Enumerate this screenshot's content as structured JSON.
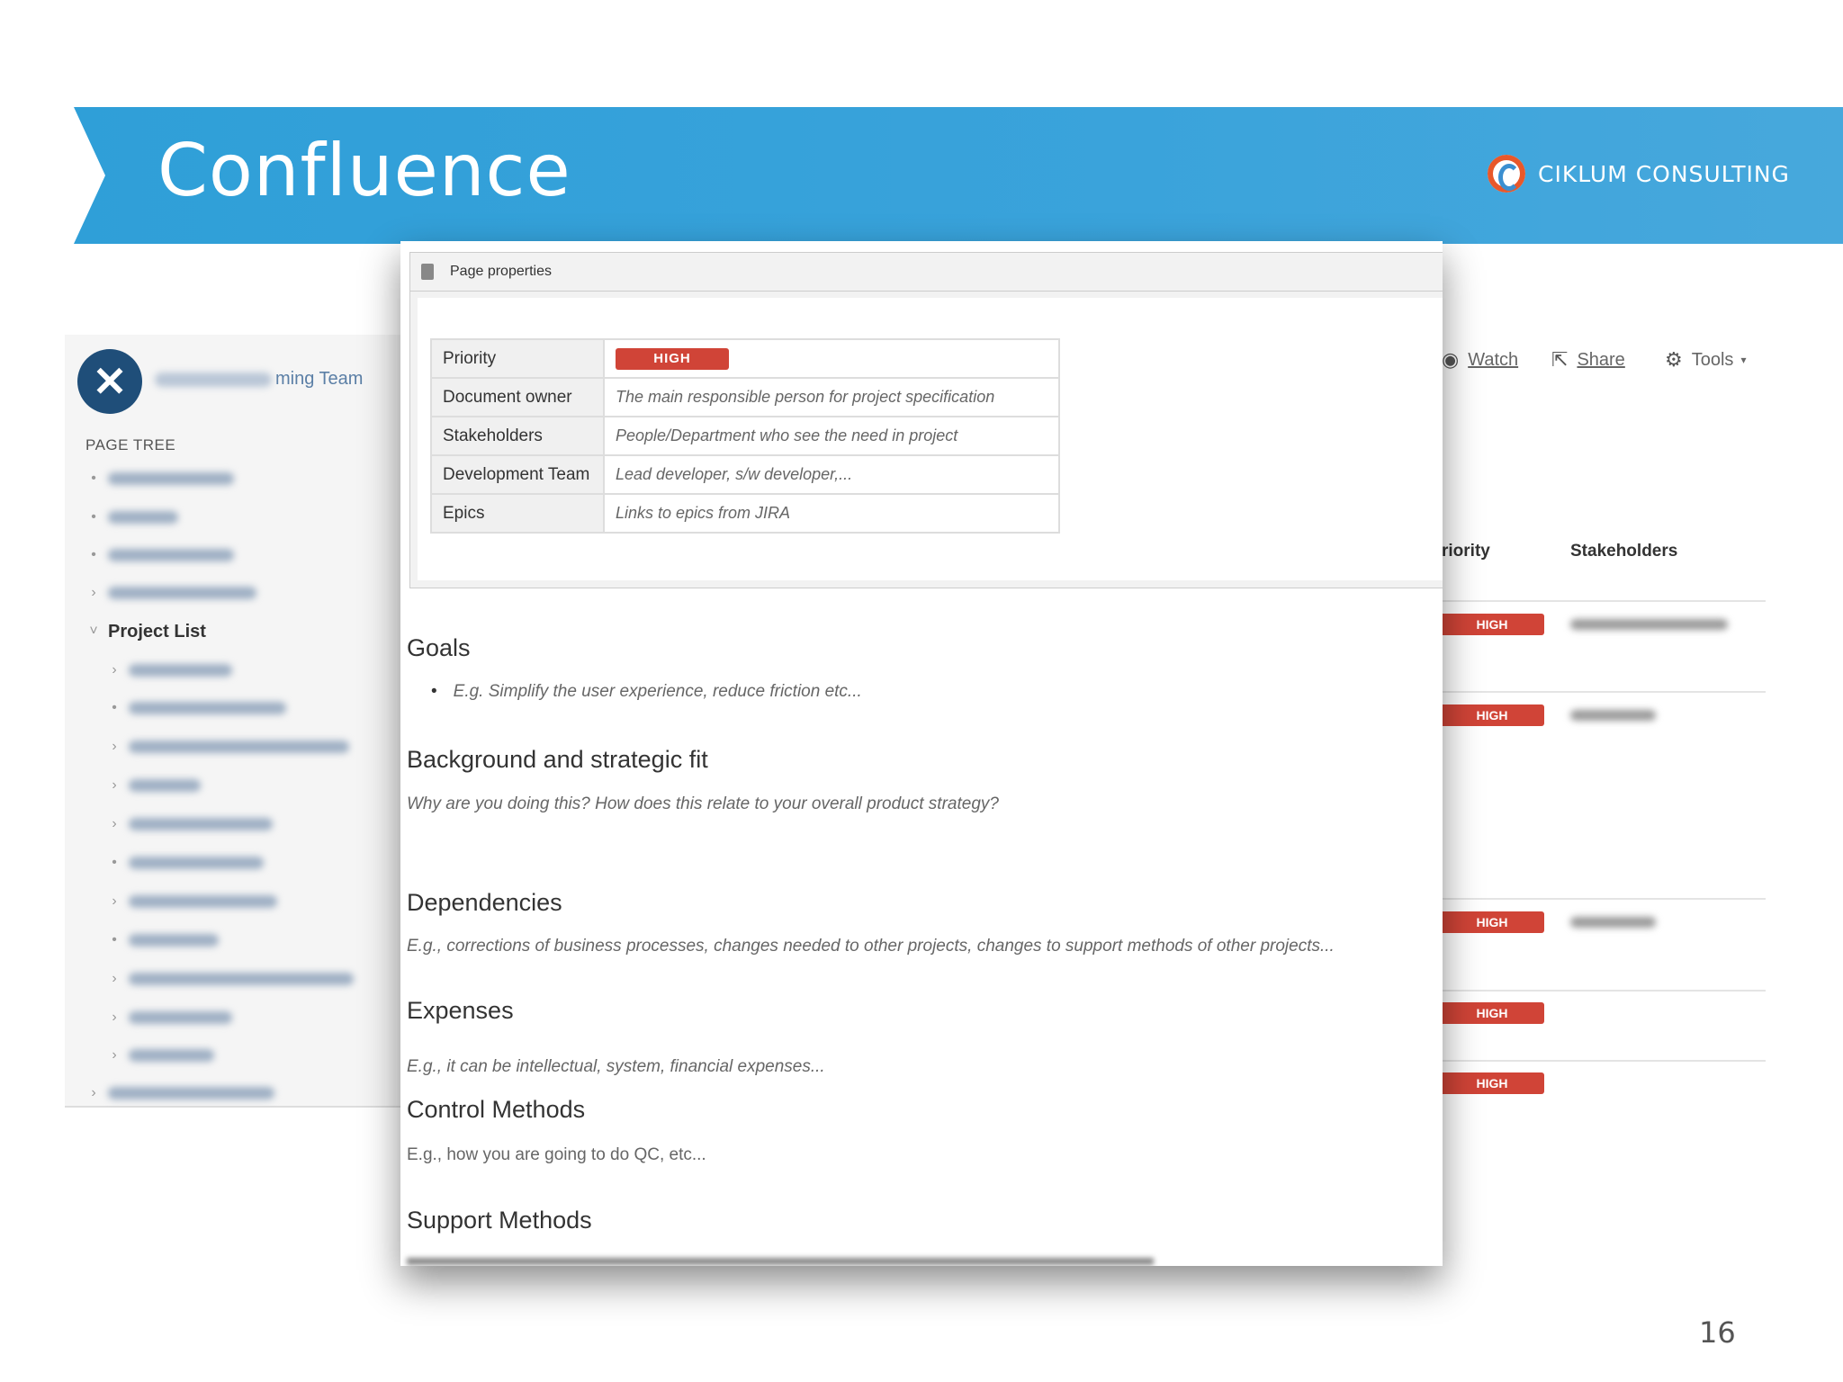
{
  "slide": {
    "title": "Confluence",
    "brand": "CIKLUM CONSULTING",
    "page_number": "16"
  },
  "sidebar": {
    "space_name_visible": "ming Team",
    "page_tree_label": "PAGE TREE",
    "project_list_label": "Project List"
  },
  "background_page": {
    "actions": {
      "watch": "Watch",
      "share": "Share",
      "tools": "Tools"
    },
    "columns": {
      "priority": "riority",
      "stakeholders": "Stakeholders"
    },
    "badges": [
      "HIGH",
      "HIGH",
      "HIGH",
      "HIGH",
      "HIGH"
    ]
  },
  "page_properties": {
    "header": "Page properties",
    "rows": [
      {
        "key": "Priority",
        "value": "HIGH"
      },
      {
        "key": "Document owner",
        "value": "The main responsible person for project specification"
      },
      {
        "key": "Stakeholders",
        "value": "People/Department who see the need in project"
      },
      {
        "key": "Development Team",
        "value": "Lead developer, s/w developer,..."
      },
      {
        "key": "Epics",
        "value": "Links to epics from JIRA"
      }
    ]
  },
  "sections": {
    "goals": {
      "heading": "Goals",
      "bullet": "E.g. Simplify the user experience, reduce friction etc..."
    },
    "background": {
      "heading": "Background and strategic fit",
      "text": "Why are you doing this? How does this relate to your overall product strategy?"
    },
    "dependencies": {
      "heading": "Dependencies",
      "text": "E.g., corrections of business processes, changes needed to other projects, changes to support methods of other projects..."
    },
    "expenses": {
      "heading": "Expenses",
      "text": "E.g., it can be intellectual, system, financial expenses..."
    },
    "control": {
      "heading": "Control Methods",
      "text": "E.g., how you are going to do QC, etc..."
    },
    "support": {
      "heading": "Support Methods"
    }
  },
  "colors": {
    "banner": "#3aa3db",
    "high_badge": "#d04437",
    "brand_accent": "#e8582a"
  }
}
